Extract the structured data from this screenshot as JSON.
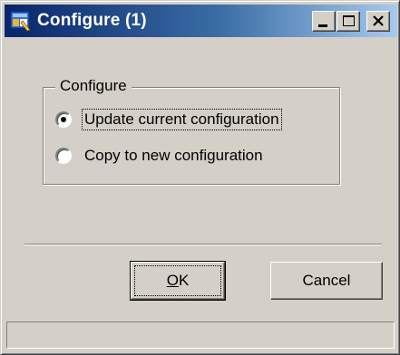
{
  "window": {
    "title": "Configure (1)",
    "title_bar_color": "#0a246a",
    "background_color": "#d4d0c8"
  },
  "icons": {
    "app": "app-icon",
    "minimize": "minimize-icon",
    "maximize": "maximize-icon",
    "close": "close-icon"
  },
  "group": {
    "legend": "Configure",
    "options": [
      {
        "label": "Update current configuration",
        "selected": true,
        "focused": true
      },
      {
        "label": "Copy to new configuration",
        "selected": false,
        "focused": false
      }
    ]
  },
  "buttons": {
    "ok": {
      "label_prefix": "",
      "label_mnemonic": "O",
      "label_suffix": "K"
    },
    "cancel": {
      "label": "Cancel"
    }
  },
  "statusbar": {
    "text": ""
  }
}
